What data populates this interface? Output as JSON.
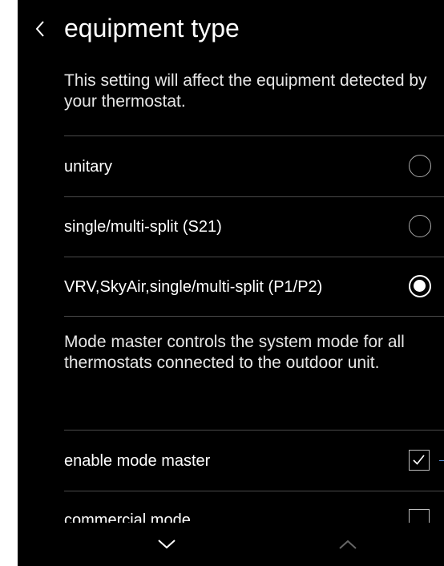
{
  "header": {
    "title": "equipment type"
  },
  "intro_text": "This setting will affect the equipment detected by your thermostat.",
  "equipment_options": [
    {
      "label": "unitary",
      "selected": false
    },
    {
      "label": "single/multi-split (S21)",
      "selected": false
    },
    {
      "label": "VRV,SkyAir,single/multi-split (P1/P2)",
      "selected": true
    }
  ],
  "mode_master_text": "Mode master controls the system mode for all thermostats connected to the outdoor unit.",
  "toggles": [
    {
      "label": "enable mode master",
      "checked": true
    },
    {
      "label": "commercial mode",
      "checked": false
    }
  ],
  "icons": {
    "back": "chevron-left-icon",
    "scroll_down": "chevron-down-icon",
    "scroll_up": "chevron-up-icon"
  },
  "colors": {
    "background": "#000000",
    "text": "#ffffff",
    "divider": "#4a4a4a",
    "disabled_arrow": "#666666"
  }
}
